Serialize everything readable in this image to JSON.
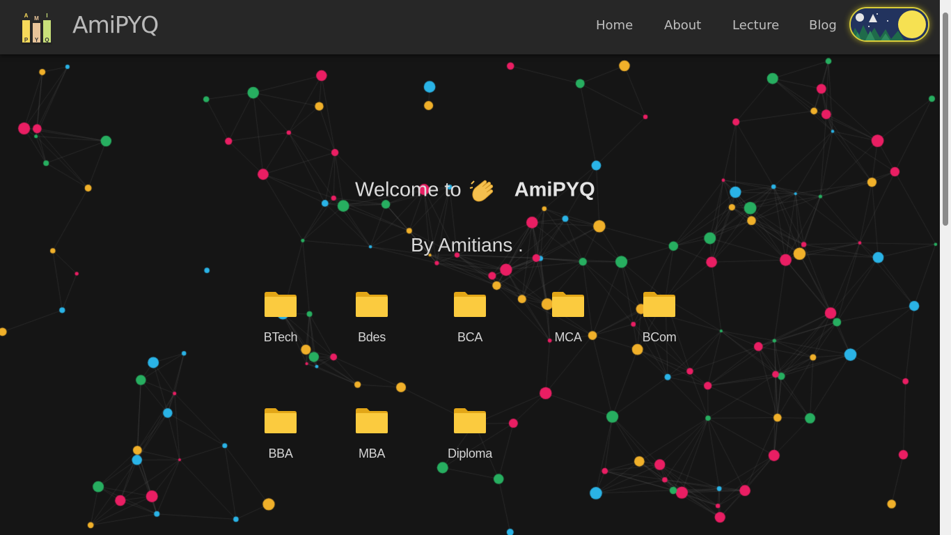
{
  "header": {
    "brand": "AmiPYQ",
    "logo_letters": [
      "A",
      "M",
      "I",
      "P",
      "Y",
      "Q"
    ],
    "nav": [
      {
        "label": "Home"
      },
      {
        "label": "About"
      },
      {
        "label": "Lecture"
      },
      {
        "label": "Blog"
      }
    ],
    "theme_toggle": {
      "state": "night-to-day",
      "icon": "moon-sun-toggle-icon"
    }
  },
  "hero": {
    "welcome_prefix": "Welcome to",
    "wave_icon": "waving-hand-icon",
    "brand": "AmiPYQ",
    "byline": "By Amitians ."
  },
  "courses": [
    {
      "label": "BTech",
      "icon": "folder-icon"
    },
    {
      "label": "Bdes",
      "icon": "folder-icon"
    },
    {
      "label": "BCA",
      "icon": "folder-icon"
    },
    {
      "label": "MCA",
      "icon": "folder-icon"
    },
    {
      "label": "BCom",
      "icon": "folder-icon"
    },
    {
      "label": "BBA",
      "icon": "folder-icon"
    },
    {
      "label": "MBA",
      "icon": "folder-icon"
    },
    {
      "label": "Diploma",
      "icon": "folder-icon"
    }
  ],
  "colors": {
    "background": "#151515",
    "header": "#272727",
    "folder": "#f8c83c",
    "particles": [
      "#e91e63",
      "#2ab3e6",
      "#f0b02a",
      "#27ae60"
    ]
  }
}
